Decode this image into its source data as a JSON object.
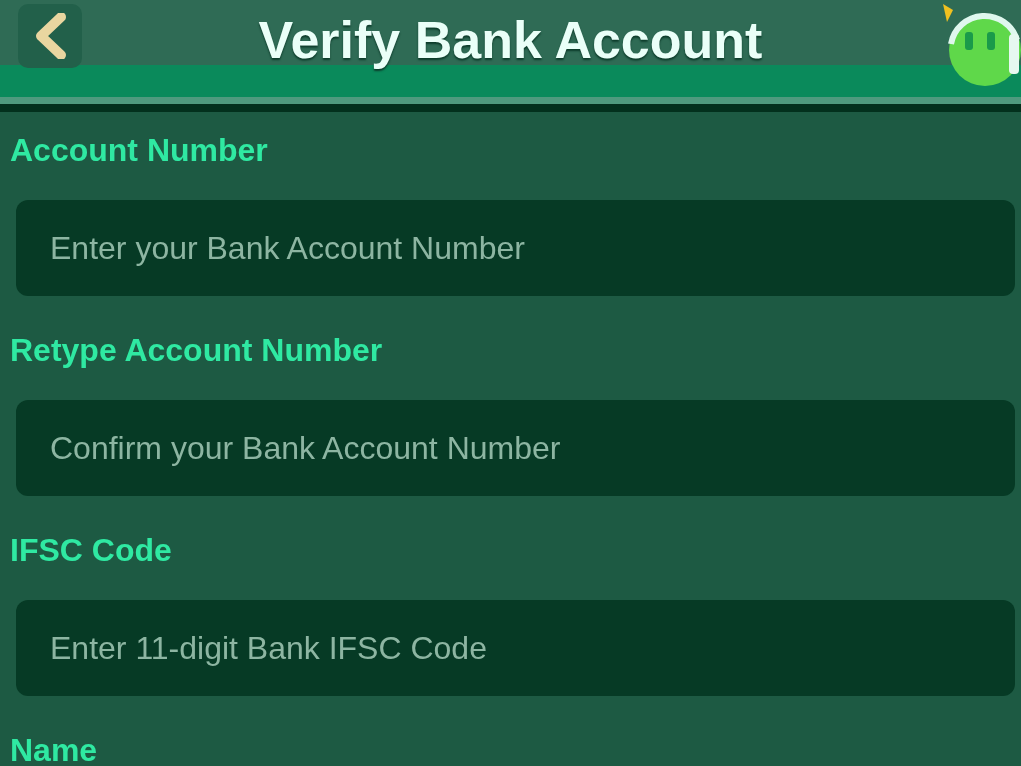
{
  "header": {
    "title": "Verify Bank Account"
  },
  "fields": [
    {
      "label": "Account Number",
      "placeholder": "Enter your Bank Account Number"
    },
    {
      "label": "Retype Account Number",
      "placeholder": "Confirm your Bank Account Number"
    },
    {
      "label": "IFSC Code",
      "placeholder": "Enter 11-digit Bank IFSC Code"
    },
    {
      "label": "Name"
    }
  ]
}
